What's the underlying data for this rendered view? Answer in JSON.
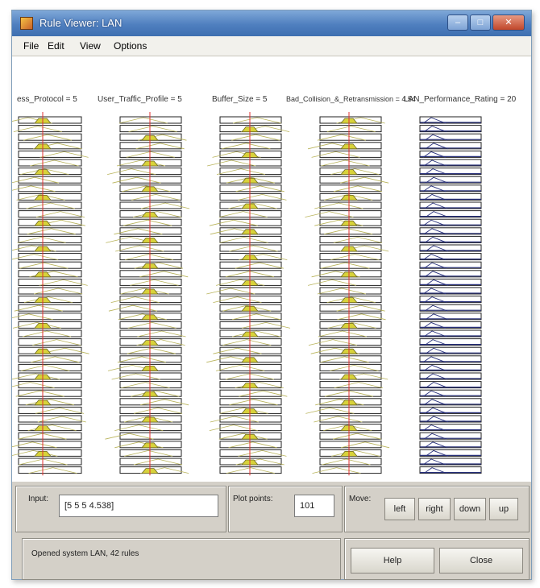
{
  "window": {
    "title": "Rule Viewer: LAN",
    "min_glyph": "–",
    "max_glyph": "□",
    "close_glyph": "✕"
  },
  "menu": {
    "file": "File",
    "edit": "Edit",
    "view": "View",
    "options": "Options"
  },
  "columns": {
    "c1": "ess_Protocol = 5",
    "c2": "User_Traffic_Profile = 5",
    "c3": "Buffer_Size = 5",
    "c4": "Bad_Collision_&_Retransmission = 4.54",
    "c5": "LAN_Performance_Rating = 20"
  },
  "colors": {
    "index_line": "#e03030",
    "mf_fill": "#d8d23a",
    "output_mf": "#28307a",
    "panel": "#d4d0c8"
  },
  "icons": [
    "app-icon",
    "minimize-icon",
    "maximize-icon",
    "close-icon"
  ],
  "input": {
    "label": "Input:",
    "value": "[5 5 5 4.538]"
  },
  "plot_points": {
    "label": "Plot points:",
    "value": "101"
  },
  "move": {
    "label": "Move:",
    "left": "left",
    "right": "right",
    "down": "down",
    "up": "up"
  },
  "status": "Opened system LAN, 42 rules",
  "buttons": {
    "help": "Help",
    "close": "Close"
  }
}
